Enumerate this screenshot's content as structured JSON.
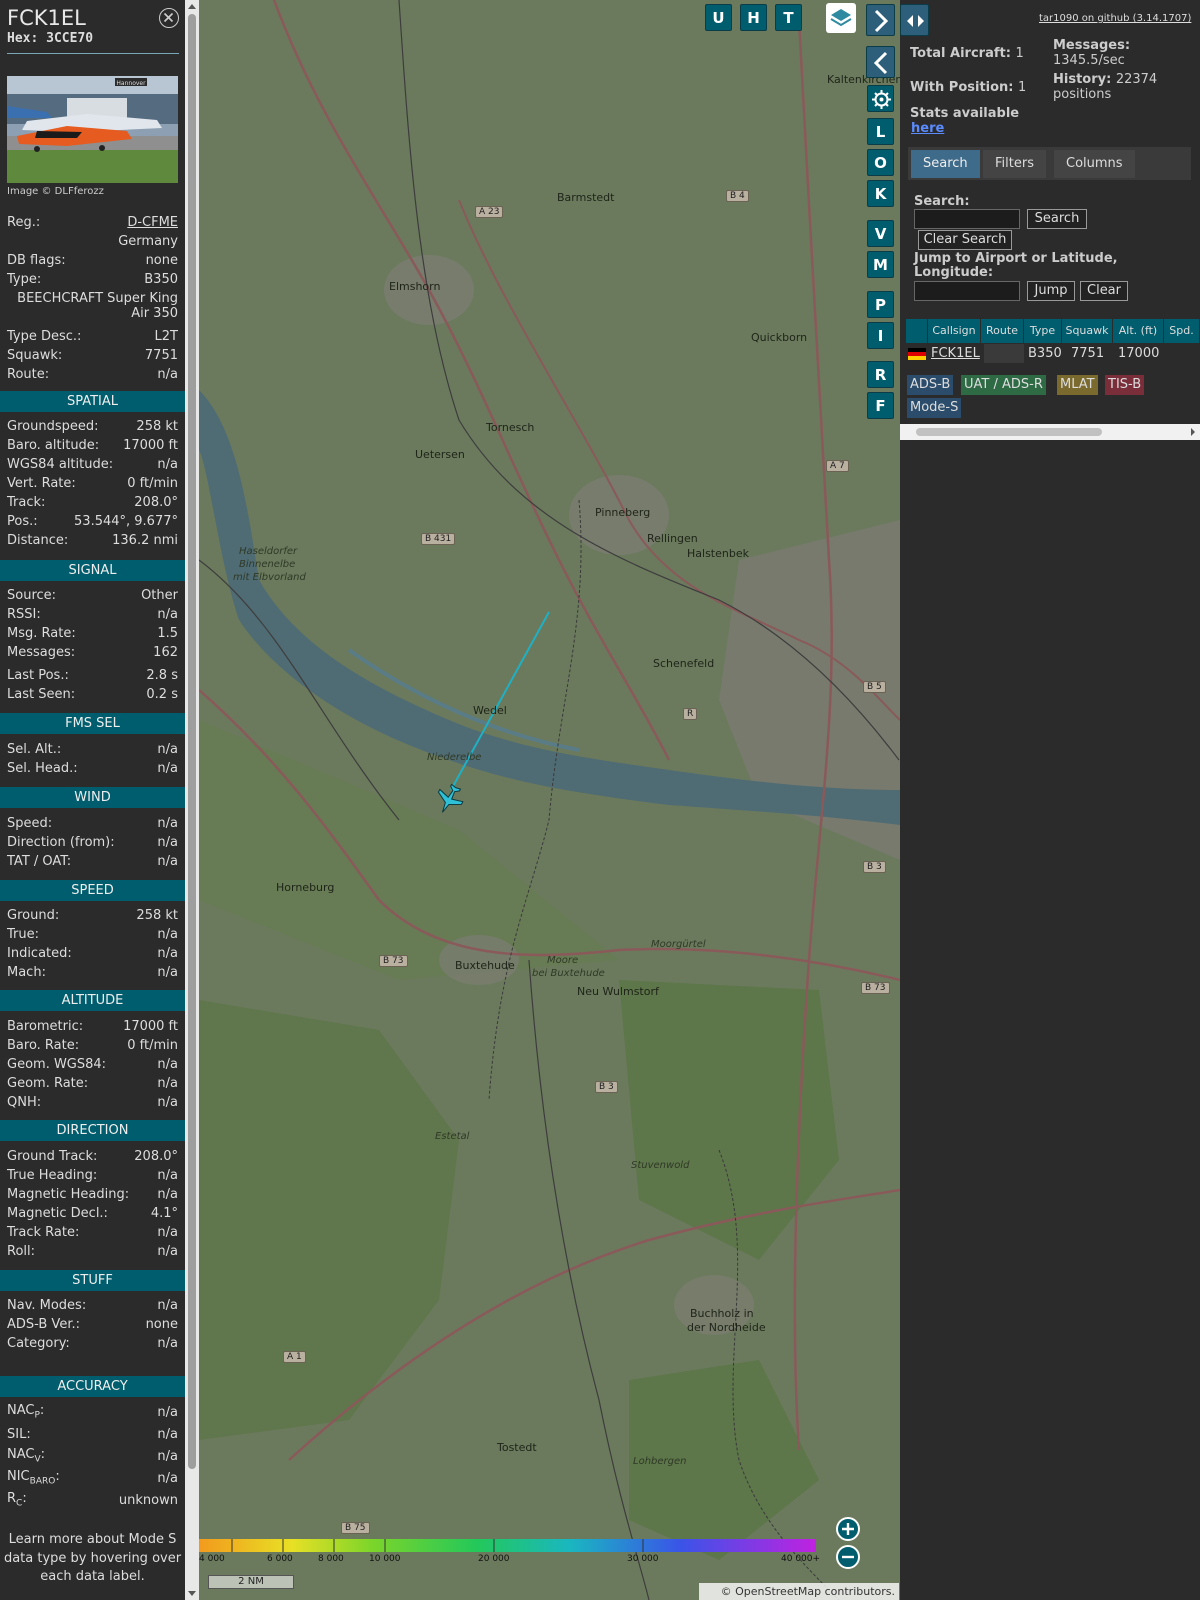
{
  "aircraft": {
    "callsign": "FCK1EL",
    "hex_label": "Hex: 3CCE70",
    "image_credit": "Image © DLFferozz",
    "photo_text": "Hannover",
    "reg_label": "Reg.:",
    "reg": "D-CFME",
    "country": "Germany",
    "dbflags_label": "DB flags:",
    "dbflags": "none",
    "type_label": "Type:",
    "type": "B350",
    "type_name_1": "BEECHCRAFT Super King",
    "type_name_2": "Air 350",
    "typedesc_label": "Type Desc.:",
    "typedesc": "L2T",
    "squawk_label": "Squawk:",
    "squawk": "7751",
    "route_label": "Route:",
    "route": "n/a"
  },
  "sections": {
    "spatial": "SPATIAL",
    "signal": "SIGNAL",
    "fms": "FMS SEL",
    "wind": "WIND",
    "speed": "SPEED",
    "altitude": "ALTITUDE",
    "direction": "DIRECTION",
    "stuff": "STUFF",
    "accuracy": "ACCURACY"
  },
  "spatial": [
    {
      "k": "Groundspeed:",
      "v": "258 kt"
    },
    {
      "k": "Baro. altitude:",
      "v": "17000 ft"
    },
    {
      "k": "WGS84 altitude:",
      "v": "n/a"
    },
    {
      "k": "Vert. Rate:",
      "v": "0 ft/min"
    },
    {
      "k": "Track:",
      "v": "208.0°"
    },
    {
      "k": "Pos.:",
      "v": "53.544°, 9.677°"
    },
    {
      "k": "Distance:",
      "v": "136.2 nmi"
    }
  ],
  "signal": [
    {
      "k": "Source:",
      "v": "Other"
    },
    {
      "k": "RSSI:",
      "v": "n/a"
    },
    {
      "k": "Msg. Rate:",
      "v": "1.5"
    },
    {
      "k": "Messages:",
      "v": "162"
    },
    {
      "k": "Last Pos.:",
      "v": "2.8 s"
    },
    {
      "k": "Last Seen:",
      "v": "0.2 s"
    }
  ],
  "fms": [
    {
      "k": "Sel. Alt.:",
      "v": "n/a"
    },
    {
      "k": "Sel. Head.:",
      "v": "n/a"
    }
  ],
  "wind": [
    {
      "k": "Speed:",
      "v": "n/a"
    },
    {
      "k": "Direction (from):",
      "v": "n/a"
    },
    {
      "k": "TAT / OAT:",
      "v": "n/a"
    }
  ],
  "speed": [
    {
      "k": "Ground:",
      "v": "258 kt"
    },
    {
      "k": "True:",
      "v": "n/a"
    },
    {
      "k": "Indicated:",
      "v": "n/a"
    },
    {
      "k": "Mach:",
      "v": "n/a"
    }
  ],
  "altitude": [
    {
      "k": "Barometric:",
      "v": "17000 ft"
    },
    {
      "k": "Baro. Rate:",
      "v": "0 ft/min"
    },
    {
      "k": "Geom. WGS84:",
      "v": "n/a"
    },
    {
      "k": "Geom. Rate:",
      "v": "n/a"
    },
    {
      "k": "QNH:",
      "v": "n/a"
    }
  ],
  "direction": [
    {
      "k": "Ground Track:",
      "v": "208.0°"
    },
    {
      "k": "True Heading:",
      "v": "n/a"
    },
    {
      "k": "Magnetic Heading:",
      "v": "n/a"
    },
    {
      "k": "Magnetic Decl.:",
      "v": "4.1°"
    },
    {
      "k": "Track Rate:",
      "v": "n/a"
    },
    {
      "k": "Roll:",
      "v": "n/a"
    }
  ],
  "stuff": [
    {
      "k": "Nav. Modes:",
      "v": "n/a"
    },
    {
      "k": "ADS-B Ver.:",
      "v": "none"
    },
    {
      "k": "Category:",
      "v": "n/a"
    }
  ],
  "accuracy": [
    {
      "k": "NAC",
      "sub": "P",
      "v": "n/a"
    },
    {
      "k": "SIL:",
      "sub": "",
      "v": "n/a"
    },
    {
      "k": "NAC",
      "sub": "V",
      "v": "n/a"
    },
    {
      "k": "NIC",
      "sub": "BARO",
      "v": "n/a"
    },
    {
      "k": "R",
      "sub": "C",
      "v": "unknown"
    }
  ],
  "learn_more": [
    "Learn more about Mode S",
    "data type by hovering over",
    "each data label."
  ],
  "map": {
    "buttons": [
      "U",
      "H",
      "T"
    ],
    "side_buttons": [
      "L",
      "O",
      "K",
      "V",
      "M",
      "P",
      "I",
      "R",
      "F"
    ],
    "places": [
      {
        "name": "Barmstedt"
      },
      {
        "name": "Elmshorn"
      },
      {
        "name": "Quickborn"
      },
      {
        "name": "Tornesch"
      },
      {
        "name": "Uetersen"
      },
      {
        "name": "Pinneberg"
      },
      {
        "name": "Rellingen"
      },
      {
        "name": "Halstenbek"
      },
      {
        "name": "Schenefeld"
      },
      {
        "name": "Wedel"
      },
      {
        "name": "Horneburg"
      },
      {
        "name": "Buxtehude"
      },
      {
        "name": "Neu Wulmstorf"
      },
      {
        "name": "Moorgürtel"
      },
      {
        "name": "Buchholz in"
      },
      {
        "name": "der Nordheide"
      },
      {
        "name": "Tostedt"
      },
      {
        "name": "Kaltenkirchen"
      },
      {
        "name": "Stuvenwold"
      },
      {
        "name": "Estetal"
      },
      {
        "name": "Lohbergen"
      },
      {
        "name": "Haseldorfer"
      },
      {
        "name": "Binnenelbe"
      },
      {
        "name": "mit Elbvorland"
      },
      {
        "name": "Moore"
      },
      {
        "name": "bei Buxtehude"
      },
      {
        "name": "Niederelbe"
      }
    ],
    "roads": [
      "A 23",
      "B 4",
      "B 431",
      "A 7",
      "B 5",
      "B 3",
      "B 73",
      "B 3",
      "A 1",
      "B 75",
      "B 73",
      "R"
    ],
    "colorbar_ticks": [
      "4 000",
      "6 000",
      "8 000",
      "10 000",
      "20 000",
      "30 000",
      "40 000+"
    ],
    "scale": "2 NM",
    "attribution": "© OpenStreetMap contributors."
  },
  "right": {
    "total_aircraft_label": "Total Aircraft:",
    "total_aircraft": "1",
    "with_position_label": "With Position:",
    "with_position": "1",
    "stats_label": "Stats available",
    "stats_link": "here",
    "messages_label": "Messages:",
    "messages": "1345.5/sec",
    "history_label": "History:",
    "history": "22374",
    "history_unit": "positions",
    "github": "tar1090 on github (3.14.1707)",
    "tabs": [
      "Search",
      "Filters",
      "Columns"
    ],
    "search_label": "Search:",
    "search_button": "Search",
    "clear_search": "Clear Search",
    "jump_label_1": "Jump to Airport or Latitude,",
    "jump_label_2": "Longitude:",
    "jump_button": "Jump",
    "clear_button": "Clear",
    "columns": [
      "Callsign",
      "Route",
      "Type",
      "Squawk",
      "Alt. (ft)",
      "Spd."
    ],
    "row": {
      "callsign": "FCK1EL",
      "route": "",
      "type": "B350",
      "squawk": "7751",
      "alt": "17000"
    },
    "sources": [
      {
        "label": "ADS-B",
        "color": "#2b4d6b"
      },
      {
        "label": "UAT / ADS-R",
        "color": "#2e6b45"
      },
      {
        "label": "MLAT",
        "color": "#7a6a2e"
      },
      {
        "label": "TIS-B",
        "color": "#7a2e3a"
      },
      {
        "label": "Mode-S",
        "color": "#2b4d6b"
      }
    ]
  }
}
